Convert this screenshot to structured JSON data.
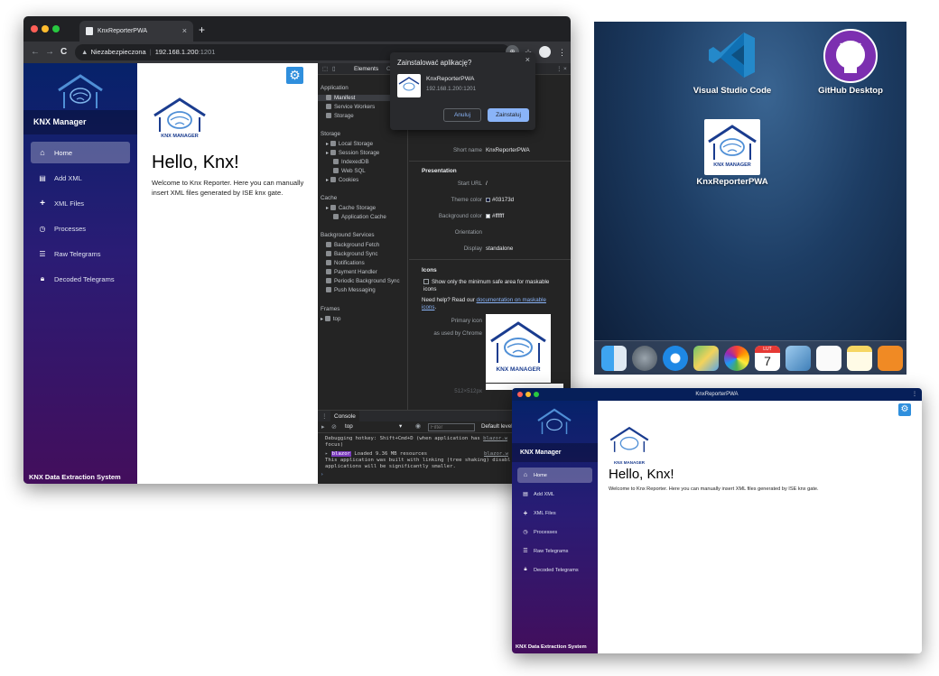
{
  "browser": {
    "tab_title": "KnxReporterPWA",
    "tab_close": "×",
    "new_tab": "+",
    "back": "←",
    "forward": "→",
    "reload": "C",
    "security_label": "Niezabezpieczona",
    "url_host": "192.168.1.200",
    "url_port": ":1201"
  },
  "app": {
    "logo_text": "KNX MANAGER",
    "brand": "KNX Manager",
    "nav": [
      {
        "label": "Home",
        "icon": "home-icon"
      },
      {
        "label": "Add XML",
        "icon": "document-icon"
      },
      {
        "label": "XML Files",
        "icon": "plus-icon"
      },
      {
        "label": "Processes",
        "icon": "clock-icon"
      },
      {
        "label": "Raw Telegrams",
        "icon": "list-icon"
      },
      {
        "label": "Decoded Telegrams",
        "icon": "lock-icon"
      }
    ],
    "footer": "KNX Data Extraction System",
    "heading": "Hello, Knx!",
    "welcome": "Welcome to Knx Reporter. Here you can manually insert XML files generated by ISE knx gate."
  },
  "devtools": {
    "tab_elements": "Elements",
    "tab_more": "C",
    "application_group": "Application",
    "application_items": [
      "Manifest",
      "Service Workers",
      "Storage"
    ],
    "storage_group": "Storage",
    "storage_items": [
      "Local Storage",
      "Session Storage",
      "IndexedDB",
      "Web SQL",
      "Cookies"
    ],
    "cache_group": "Cache",
    "cache_items": [
      "Cache Storage",
      "Application Cache"
    ],
    "bg_group": "Background Services",
    "bg_items": [
      "Background Fetch",
      "Background Sync",
      "Notifications",
      "Payment Handler",
      "Periodic Background Sync",
      "Push Messaging"
    ],
    "frames_group": "Frames",
    "frames_items": [
      "top"
    ],
    "short_name_key": "Short name",
    "short_name_val": "KnxReporterPWA",
    "presentation": "Presentation",
    "start_url_key": "Start URL",
    "start_url_val": "/",
    "theme_color_key": "Theme color",
    "theme_color_val": "#03173d",
    "bg_color_key": "Background color",
    "bg_color_val": "#ffffff",
    "orientation_key": "Orientation",
    "display_key": "Display",
    "display_val": "standalone",
    "icons": "Icons",
    "maskable_label": "Show only the minimum safe area for maskable icons",
    "help_prefix": "Need help? Read our ",
    "help_link": "documentation on maskable icons",
    "help_suffix": ".",
    "primary_icon_key": "Primary icon",
    "used_by_key": "as used by Chrome",
    "icon_size": "512×512px",
    "console_tab": "Console",
    "context": "top",
    "filter_placeholder": "Filter",
    "levels": "Default levels",
    "log1a": "Debugging hotkey: Shift+Cmd+D (when application has",
    "log1b": "focus)",
    "log1_src": "blazor.w",
    "log2_tag": "blazor",
    "log2a": " Loaded 9.36 MB resources",
    "log2_src": "blazor.w",
    "log2b": "This application was built with linking (tree shaking) disabl",
    "log2c": "applications will be significantly smaller.",
    "prompt": "›",
    "colors": {
      "theme": "#03173d",
      "background": "#ffffff"
    }
  },
  "install_dialog": {
    "title": "Zainstalować aplikację?",
    "close": "×",
    "app_name": "KnxReporterPWA",
    "app_url": "192.168.1.200:1201",
    "cancel": "Anuluj",
    "install": "Zainstaluj"
  },
  "desktop": {
    "apps": [
      {
        "label": "Visual Studio Code",
        "icon": "vscode-icon"
      },
      {
        "label": "GitHub Desktop",
        "icon": "github-desktop-icon"
      },
      {
        "label": "KnxReporterPWA",
        "icon": "knx-manager-icon"
      }
    ],
    "calendar_month": "LUT",
    "calendar_day": "7"
  },
  "pwa": {
    "title": "KnxReporterPWA"
  }
}
